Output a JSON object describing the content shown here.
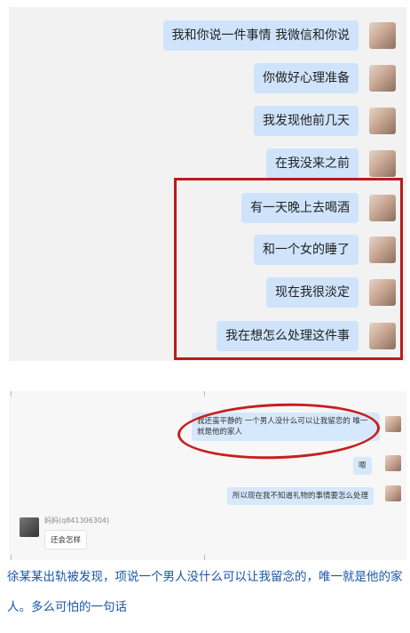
{
  "top_chat": {
    "messages": [
      "我和你说一件事情 我微信和你说",
      "你做好心理准备",
      "我发现他前几天",
      "在我没来之前",
      "有一天晚上去喝酒",
      "和一个女的睡了",
      "现在我很淡定",
      "我在想怎么处理这件事"
    ]
  },
  "bottom_chat": {
    "msg1": "我还蛮平静的 一个男人没什么可以让我留恋的 唯一就是他的家人",
    "msg2": "嗯",
    "msg3": "所以现在我不知道礼物的事情要怎么处理",
    "sender_name": "妈妈(q841306304)",
    "reply": "还会怎样"
  },
  "caption": {
    "text": "徐某某出轨被发现，项说一个男人没什么可以让我留念的，唯一就是他的家人。多么可怕的一句话"
  }
}
